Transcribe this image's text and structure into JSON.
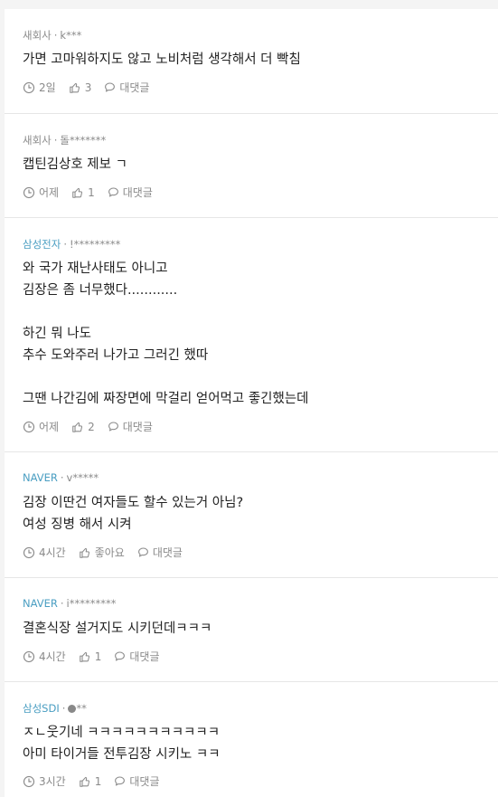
{
  "comments": [
    {
      "company": "새회사",
      "user": "k***",
      "body": "가면 고마워하지도 않고 노비처럼 생각해서 더 빡침",
      "time": "2일",
      "likes": "3",
      "reply_label": "대댓글"
    },
    {
      "company": "새회사",
      "user": "돌*******",
      "body": "캡틴김상호 제보 ㄱ",
      "time": "어제",
      "likes": "1",
      "reply_label": "대댓글"
    },
    {
      "company": "삼성전자",
      "user": "!*********",
      "body": "와 국가 재난사태도 아니고\n김장은 좀 너무했다............\n\n하긴 뭐 나도\n추수 도와주러 나가고 그러긴 했따\n\n그땐 나간김에 짜장면에 막걸리 얻어먹고 좋긴했는데",
      "time": "어제",
      "likes": "2",
      "reply_label": "대댓글"
    },
    {
      "company": "NAVER",
      "user": "v*****",
      "body": "김장 이딴건 여자들도 할수 있는거 아님?\n여성 징병 해서 시켜",
      "time": "4시간",
      "likes": "좋아요",
      "reply_label": "대댓글"
    },
    {
      "company": "NAVER",
      "user": "i*********",
      "body": "결혼식장 설거지도 시키던데ㅋㅋㅋ",
      "time": "4시간",
      "likes": "1",
      "reply_label": "대댓글"
    },
    {
      "company": "삼성SDI",
      "user": "**",
      "body": "ㅈㄴ웃기네 ㅋㅋㅋㅋㅋㅋㅋㅋㅋㅋㅋ\n아미 타이거들 전투김장 시키노 ㅋㅋ",
      "time": "3시간",
      "likes": "1",
      "reply_label": "대댓글"
    }
  ],
  "colors": {
    "accent_company": "#4a9ec2",
    "meta_gray": "#8a8a8a",
    "text": "#222222",
    "background": "#f4f4f4"
  },
  "icons": {
    "time": "clock-icon",
    "like": "thumbs-up-icon",
    "reply": "speech-bubble-icon"
  }
}
